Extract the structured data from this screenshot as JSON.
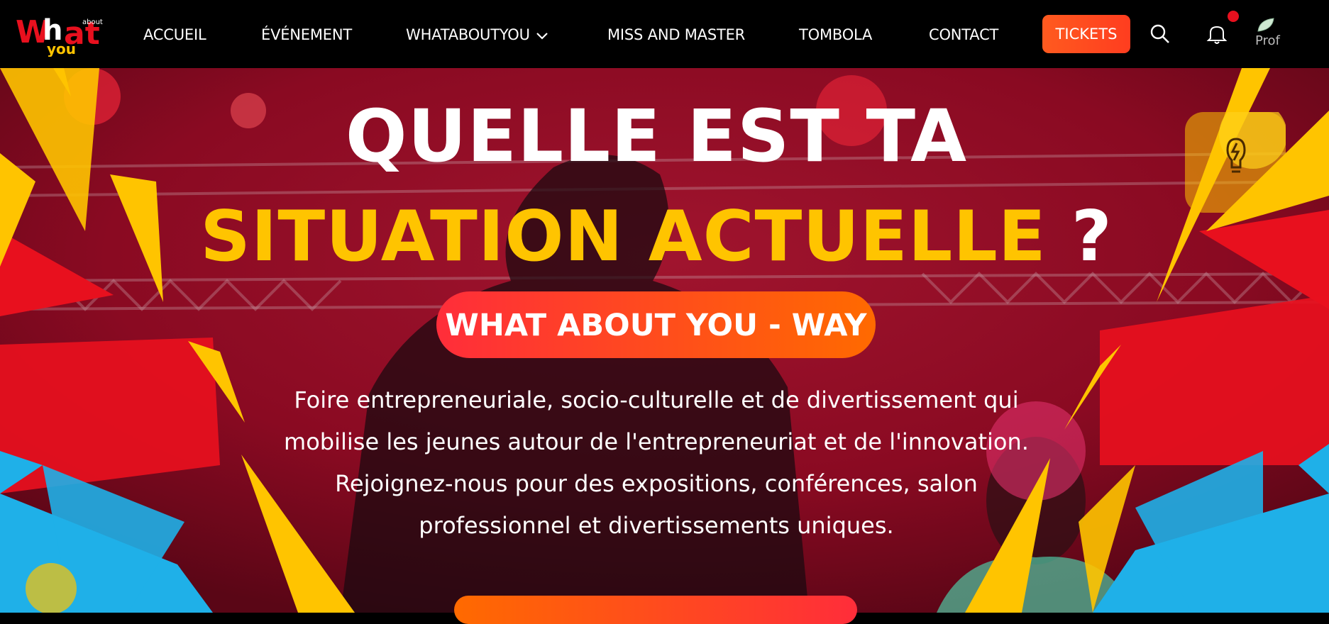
{
  "brand": {
    "logo_alt": "What about you"
  },
  "nav": {
    "items": [
      "ACCUEIL",
      "ÉVÉNEMENT",
      "WHATABOUTYOU",
      "MISS AND MASTER",
      "TOMBOLA",
      "CONTACT"
    ],
    "tickets_label": "TICKETS",
    "profile_alt": "Prof"
  },
  "hero": {
    "title_line1": "QUELLE EST TA",
    "title_line2_highlight": "SITUATION ACTUELLE",
    "title_line2_mark": " ?",
    "pill_label": "WHAT ABOUT YOU - WAY",
    "description": "Foire entrepreneuriale, socio-culturelle et de divertissement qui mobilise les jeunes autour de l'entrepreneuriat et de l'innovation. Rejoignez-nous pour des expositions, conférences, salon professionnel et divertissements uniques."
  },
  "icons": [
    "search-icon",
    "bell-icon",
    "avatar-icon",
    "lightbulb-icon",
    "chevron-down-icon"
  ],
  "colors": {
    "accent_orange": "#ff5a1f",
    "accent_yellow": "#ffc400",
    "accent_red": "#e60d1e",
    "accent_blue": "#1fb0e8",
    "hero_overlay": "#8a0a22"
  }
}
